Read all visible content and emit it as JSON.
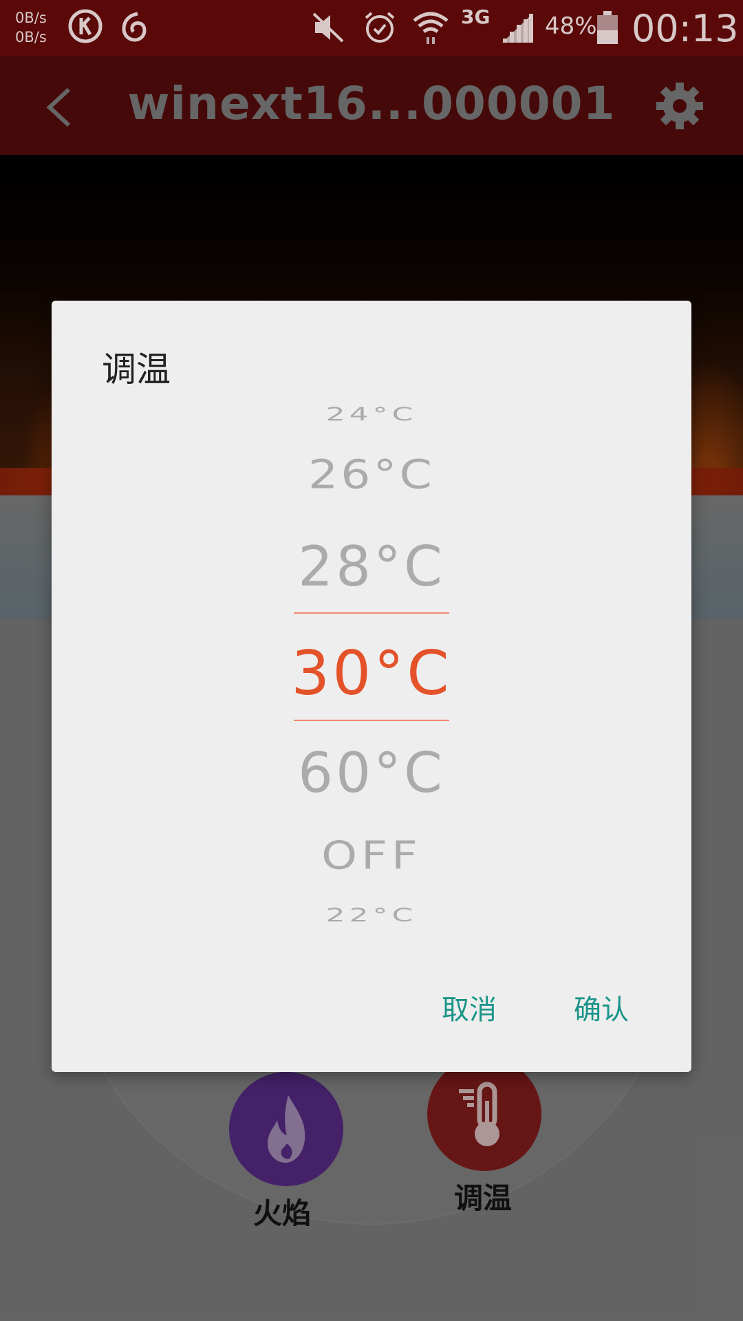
{
  "status_bar": {
    "net_up": "0B/s",
    "net_down": "0B/s",
    "network_type": "3G",
    "battery_percent": "48%",
    "time": "00:13",
    "icons": [
      "k-app-icon",
      "netease-music-icon",
      "mute-icon",
      "alarm-icon",
      "wifi-icon",
      "signal-icon",
      "battery-icon"
    ]
  },
  "app_bar": {
    "title": "winext16...000001"
  },
  "dialog": {
    "title": "调温",
    "options": [
      "24°C",
      "26°C",
      "28°C",
      "30°C",
      "60°C",
      "OFF",
      "22°C"
    ],
    "selected_index": 3,
    "cancel_label": "取消",
    "confirm_label": "确认"
  },
  "controls": {
    "flame_label": "火焰",
    "temperature_label": "调温"
  },
  "colors": {
    "status_bar": "#5a0808",
    "app_bar": "#4b0a0a",
    "selected_option": "#e4522a",
    "dialog_button": "#1a9488",
    "flame_button": "#4a2470",
    "temperature_button": "#6e1818"
  }
}
